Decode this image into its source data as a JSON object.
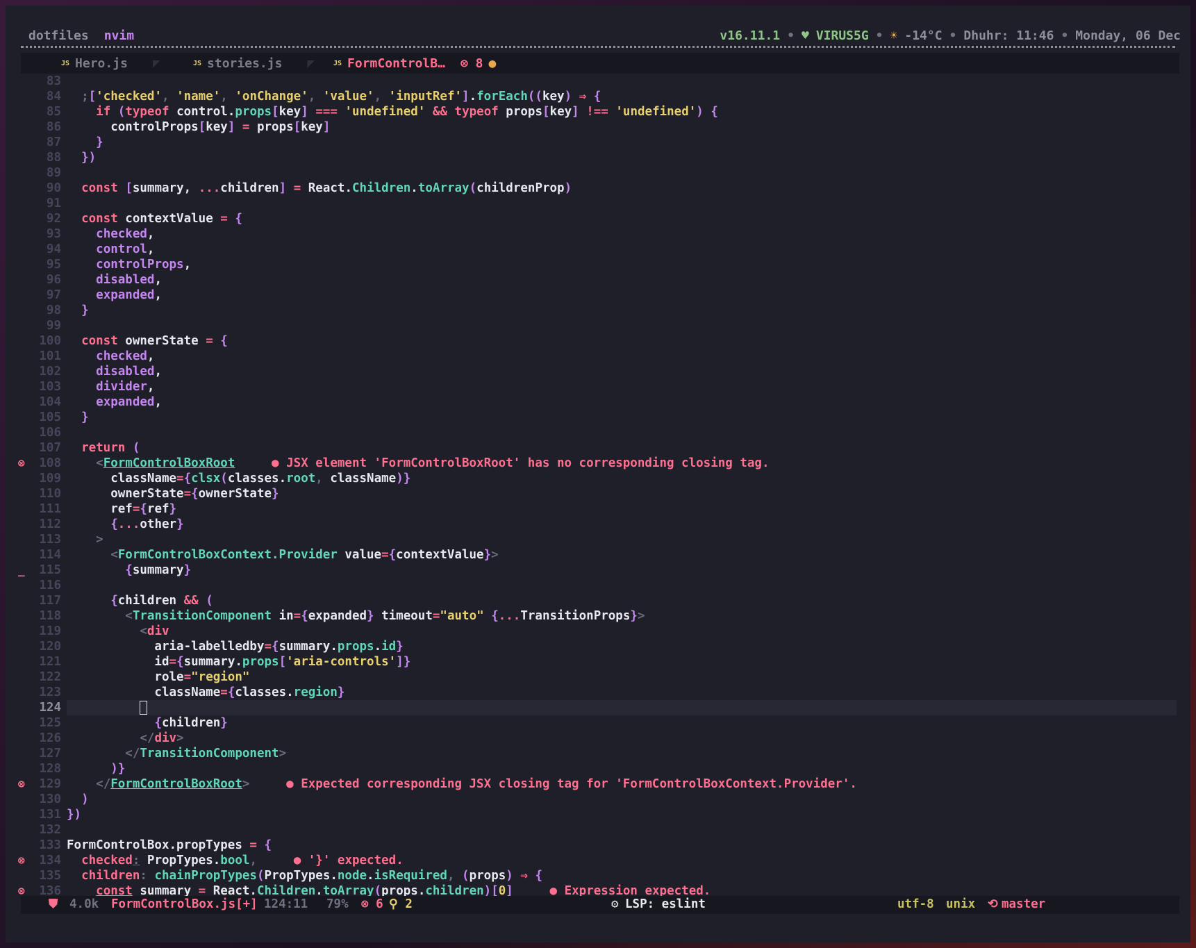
{
  "topbar": {
    "session": "dotfiles",
    "window": "nvim",
    "node_version": "v16.11.1",
    "wifi_icon": "wifi-icon",
    "network": "VIRUS5G",
    "weather_icon": "sun-icon",
    "temperature": "-14°C",
    "prayer": "Dhuhr: 11:46",
    "date": "Monday, 06 Dec",
    "bullet": "•"
  },
  "tabs": [
    {
      "name": "Hero.js",
      "icon": "JS"
    },
    {
      "name": "stories.js",
      "icon": "JS"
    },
    {
      "name": "FormControlB…",
      "icon": "JS",
      "errors": "⊗ 8",
      "modified": "●"
    }
  ],
  "diagnostics": {
    "d108": "● JSX element 'FormControlBoxRoot' has no corresponding closing tag.",
    "d129": "● Expected corresponding JSX closing tag for 'FormControlBoxContext.Provider'.",
    "d134": "● '}' expected.",
    "d136": "● Expression expected."
  },
  "statusbar": {
    "size": "4.0k",
    "file": "FormControlBox.js[+]",
    "position": "124:11",
    "percent": "79%",
    "errors": "⊗ 6",
    "hints": "⚲ 2",
    "lsp": "LSP: eslint",
    "encoding": "utf-8",
    "format": "unix",
    "branch": "master"
  },
  "colors": {
    "background": "#1e1f29",
    "keyword": "#ff6f8f",
    "property": "#c586f0",
    "string": "#e8d06e",
    "type": "#62d6b8"
  }
}
